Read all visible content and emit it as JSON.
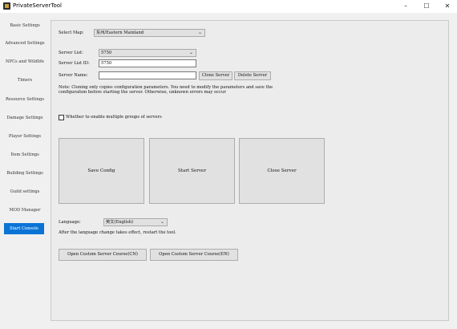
{
  "window": {
    "title": "PrivateServerTool",
    "min": "–",
    "max": "☐",
    "close": "✕"
  },
  "sidebar": {
    "items": [
      {
        "label": "Basic Settings"
      },
      {
        "label": "Advanced Settings"
      },
      {
        "label": "NPCs and Wildlife"
      },
      {
        "label": "Timers"
      },
      {
        "label": "Resource Settings"
      },
      {
        "label": "Damage Settings"
      },
      {
        "label": "Player Settings"
      },
      {
        "label": "Item Settings"
      },
      {
        "label": "Building Settings"
      },
      {
        "label": "Guild settings"
      },
      {
        "label": "MOD Manager"
      },
      {
        "label": "Start Console",
        "active": true
      }
    ]
  },
  "main": {
    "select_map": {
      "label": "Select Map:",
      "value": "东州/Eastern Mainland"
    },
    "server_list": {
      "label": "Server List:",
      "value": "5750"
    },
    "server_list_id": {
      "label": "Server List ID:",
      "value": "5750"
    },
    "server_name": {
      "label": "Server Name:",
      "value": ""
    },
    "clone_server": "Clone Server",
    "delete_server": "Delete Server",
    "note": "Note: Cloning only copies configuration parameters. You need to modify the parameters and save the configuration before starting the server. Otherwise, unknown errors may occur",
    "multi_groups": {
      "label": "Whether to enable multiple groups of servers",
      "checked": false
    },
    "save_config": "Save Config",
    "start_server": "Start Server",
    "close_server": "Close Server",
    "language": {
      "label": "Language:",
      "value": "英文(English)"
    },
    "language_note": "After the language change takes effect, restart the tool.",
    "open_course_cn": "Open Custom Server Course(CN)",
    "open_course_en": "Open Custom Server Course(EN)"
  }
}
